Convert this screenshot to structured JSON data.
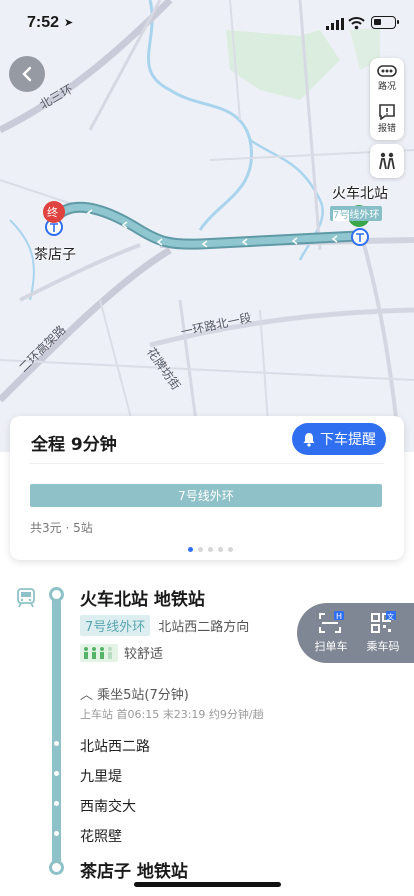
{
  "status_bar": {
    "time": "7:52",
    "location_arrow": "➤"
  },
  "map": {
    "labels": {
      "start_station": "火车北站",
      "end_station": "茶店子",
      "start_badge": "起",
      "end_badge": "终",
      "line_tag_num": "7号",
      "line_tag_rest": "线外环"
    },
    "roads": {
      "north_third_ring": "北三环",
      "second_ring_elevated": "二环高架路",
      "first_ring_north": "一环路北一段",
      "huapaifang": "花牌坊街"
    },
    "tools": {
      "traffic": "路况",
      "report": "报错"
    }
  },
  "summary": {
    "total": "全程  9分钟",
    "alarm_button": "下车提醒",
    "line_name": "7号线外环",
    "fare": "共3元 · 5站",
    "page_count": 5,
    "active_page": 0
  },
  "detail": {
    "start_name": "火车北站 地铁站",
    "line_tag": "7号线外环",
    "direction": "北站西二路方向",
    "comfort": "较舒适",
    "ride": "乘坐5站(7分钟)",
    "times": "上车站 首06:15  末23:19  约9分钟/趟",
    "stops": [
      "北站西二路",
      "九里堤",
      "西南交大",
      "花照壁"
    ],
    "end_name": "茶店子 地铁站"
  },
  "scan": {
    "scan_bike": "扫单车",
    "ride_code": "乘车码",
    "h_badge": "H",
    "wen_badge": "文"
  },
  "colors": {
    "accent": "#2f6ff0",
    "line7": "#8fc2c8",
    "start": "#3aa64a",
    "end": "#e0423f"
  }
}
